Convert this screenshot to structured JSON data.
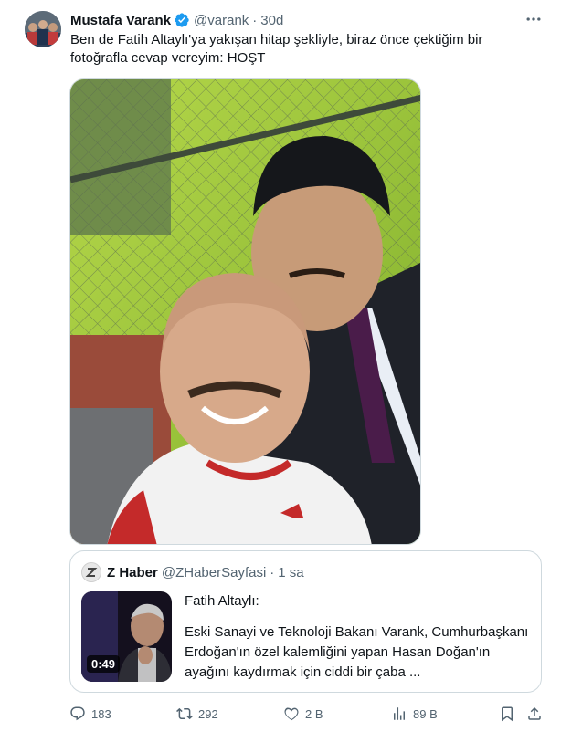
{
  "tweet": {
    "author_name": "Mustafa Varank",
    "author_handle": "@varank",
    "separator": "·",
    "time": "30d",
    "text_line1": "Ben de Fatih Altaylı'ya yakışan hitap şekliyle, biraz önce çektiğim bir",
    "text_line2": "fotoğrafla cevap vereyim: HOŞT"
  },
  "quote": {
    "author_name": "Z Haber",
    "author_handle": "@ZHaberSayfasi",
    "separator": "·",
    "time": "1 sa",
    "video_duration": "0:49",
    "title": "Fatih Altaylı:",
    "body": "Eski Sanayi ve Teknoloji Bakanı Varank, Cumhurbaşkanı Erdoğan'ın özel kalemliğini yapan Hasan Doğan'ın ayağını kaydırmak için ciddi bir çaba ..."
  },
  "actions": {
    "replies": "183",
    "reposts": "292",
    "likes": "2 B",
    "views": "89 B"
  },
  "colors": {
    "text": "#0f1419",
    "secondary": "#536471",
    "verified": "#1d9bf0",
    "border": "#cfd9de"
  },
  "icons": [
    "verified-icon",
    "more-icon",
    "reply-icon",
    "repost-icon",
    "like-icon",
    "views-icon",
    "bookmark-icon",
    "share-icon"
  ]
}
